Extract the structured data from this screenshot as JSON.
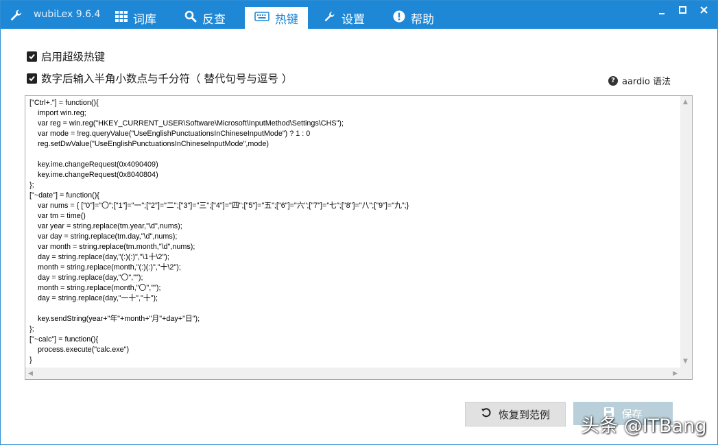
{
  "app": {
    "title": "wubiLex 9.6.4"
  },
  "tabs": [
    {
      "label": "词库",
      "icon": "grid-icon"
    },
    {
      "label": "反查",
      "icon": "search-icon"
    },
    {
      "label": "热键",
      "icon": "keyboard-icon",
      "active": true
    },
    {
      "label": "设置",
      "icon": "wrench-icon"
    },
    {
      "label": "帮助",
      "icon": "info-icon"
    }
  ],
  "options": {
    "enable_hotkey": {
      "label": "启用超级热键",
      "checked": true
    },
    "halfwidth_input": {
      "label": "数字后输入半角小数点与千分符（ 替代句号与逗号 ）",
      "checked": true
    }
  },
  "help_link": {
    "label": "aardio 语法"
  },
  "editor": {
    "code": "[\"Ctrl+.\"] = function(){\n    import win.reg;\n    var reg = win.reg(\"HKEY_CURRENT_USER\\Software\\Microsoft\\InputMethod\\Settings\\CHS\");\n    var mode = !reg.queryValue(\"UseEnglishPunctuationsInChineseInputMode\") ? 1 : 0\n    reg.setDwValue(\"UseEnglishPunctuationsInChineseInputMode\",mode)\n\n    key.ime.changeRequest(0x4090409)\n    key.ime.changeRequest(0x8040804)\n};\n[\"~date\"] = function(){\n    var nums = { [\"0\"]=\"〇\";[\"1\"]=\"一\";[\"2\"]=\"二\";[\"3\"]=\"三\";[\"4\"]=\"四\";[\"5\"]=\"五\";[\"6\"]=\"六\";[\"7\"]=\"七\";[\"8\"]=\"八\";[\"9\"]=\"九\";}\n    var tm = time()\n    var year = string.replace(tm.year,\"\\d\",nums);\n    var day = string.replace(tm.day,\"\\d\",nums);\n    var month = string.replace(tm.month,\"\\d\",nums);\n    day = string.replace(day,\"(:)(:)\",\"\\1十\\2\");\n    month = string.replace(month,\"(:)(:)\",\"十\\2\");\n    day = string.replace(day,\"〇\",\"\");\n    month = string.replace(month,\"〇\",\"\");\n    day = string.replace(day,\"一十\",\"十\");\n\n    key.sendString(year+\"年\"+month+\"月\"+day+\"日\");\n};\n[\"~calc\"] = function(){\n    process.execute(\"calc.exe\")\n}"
  },
  "buttons": {
    "restore": "恢复到范例",
    "save": "保存"
  },
  "watermark": "头条 @ITBang",
  "colors": {
    "titlebar": "#1e88d7",
    "save_button": "#b9cfd9"
  }
}
